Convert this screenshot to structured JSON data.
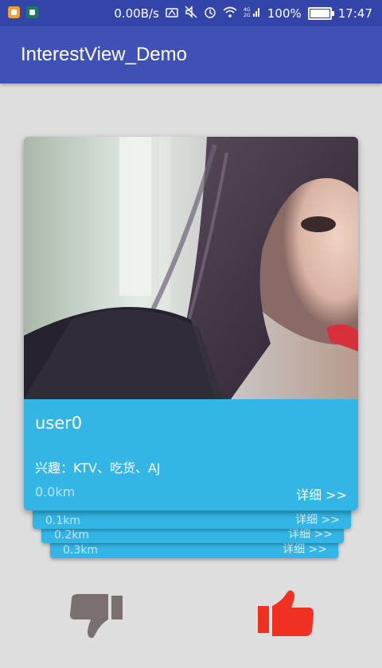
{
  "status_bar": {
    "speed": "0.00B/s",
    "network": "4G 2G",
    "battery_level": 1.0,
    "battery": "100%",
    "time": "17:47"
  },
  "app_bar": {
    "title": "InterestView_Demo"
  },
  "card": {
    "username": "user0",
    "interests": "兴趣：KTV、吃货、AJ",
    "distance": "0.0km",
    "detail_label": "详细 >>"
  },
  "stack_cards": [
    {
      "distance": "0.1km",
      "detail_label": "详细 >>"
    },
    {
      "distance": "0.2km",
      "detail_label": "详细 >>"
    },
    {
      "distance": "0.3km",
      "detail_label": "详细 >>"
    }
  ],
  "actions": {
    "dislike_icon": "thumbs-down-icon",
    "like_icon": "thumbs-up-icon",
    "dislike_color": "#7a7070",
    "like_color": "#f03020"
  },
  "colors": {
    "status_bar": "#3445aa",
    "app_bar": "#3f51b5",
    "card": "#33b5e5",
    "background": "#dedede"
  }
}
